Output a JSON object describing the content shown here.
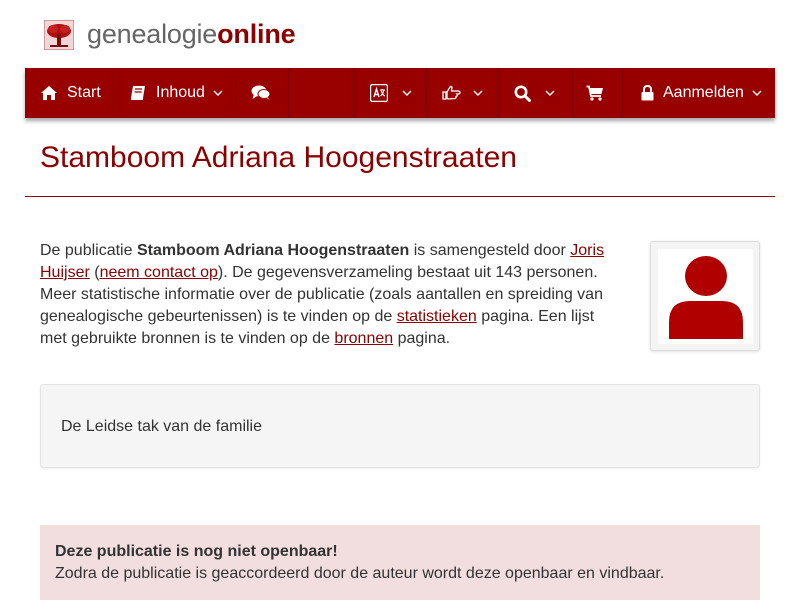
{
  "brand": {
    "part1": "genealogie",
    "part2": "online"
  },
  "nav": {
    "start": "Start",
    "inhoud": "Inhoud",
    "aanmelden": "Aanmelden"
  },
  "page": {
    "title": "Stamboom Adriana Hoogenstraaten"
  },
  "intro": {
    "t1": "De publicatie ",
    "pub_name": "Stamboom Adriana Hoogenstraaten",
    "t2": " is samengesteld door ",
    "author": "Joris Huijser",
    "t3": " (",
    "contact": "neem contact op",
    "t4": "). De gegevensverzameling bestaat uit 143 personen. Meer statistische informatie over de publicatie (zoals aantallen en spreiding van genealogische gebeurtenissen) is te vinden op de ",
    "stats": "statistieken",
    "t5": " pagina. Een lijst met gebruikte bronnen is te vinden op de ",
    "sources": "bronnen",
    "t6": " pagina."
  },
  "description": "De Leidse tak van de familie",
  "alert": {
    "title": "Deze publicatie is nog niet openbaar!",
    "text": "Zodra de publicatie is geaccordeerd door de auteur wordt deze openbaar en vindbaar."
  },
  "colors": {
    "brand_red": "#980000",
    "title_red": "#8b0000",
    "alert_bg": "#f2dede"
  },
  "icons": {
    "logo": "tree-icon",
    "start": "home-icon",
    "inhoud": "book-icon",
    "chat": "comments-icon",
    "language": "language-icon",
    "share": "hand-point-right-icon",
    "search": "search-icon",
    "cart": "shopping-cart-icon",
    "login": "lock-icon",
    "avatar": "user-silhouette-icon"
  }
}
